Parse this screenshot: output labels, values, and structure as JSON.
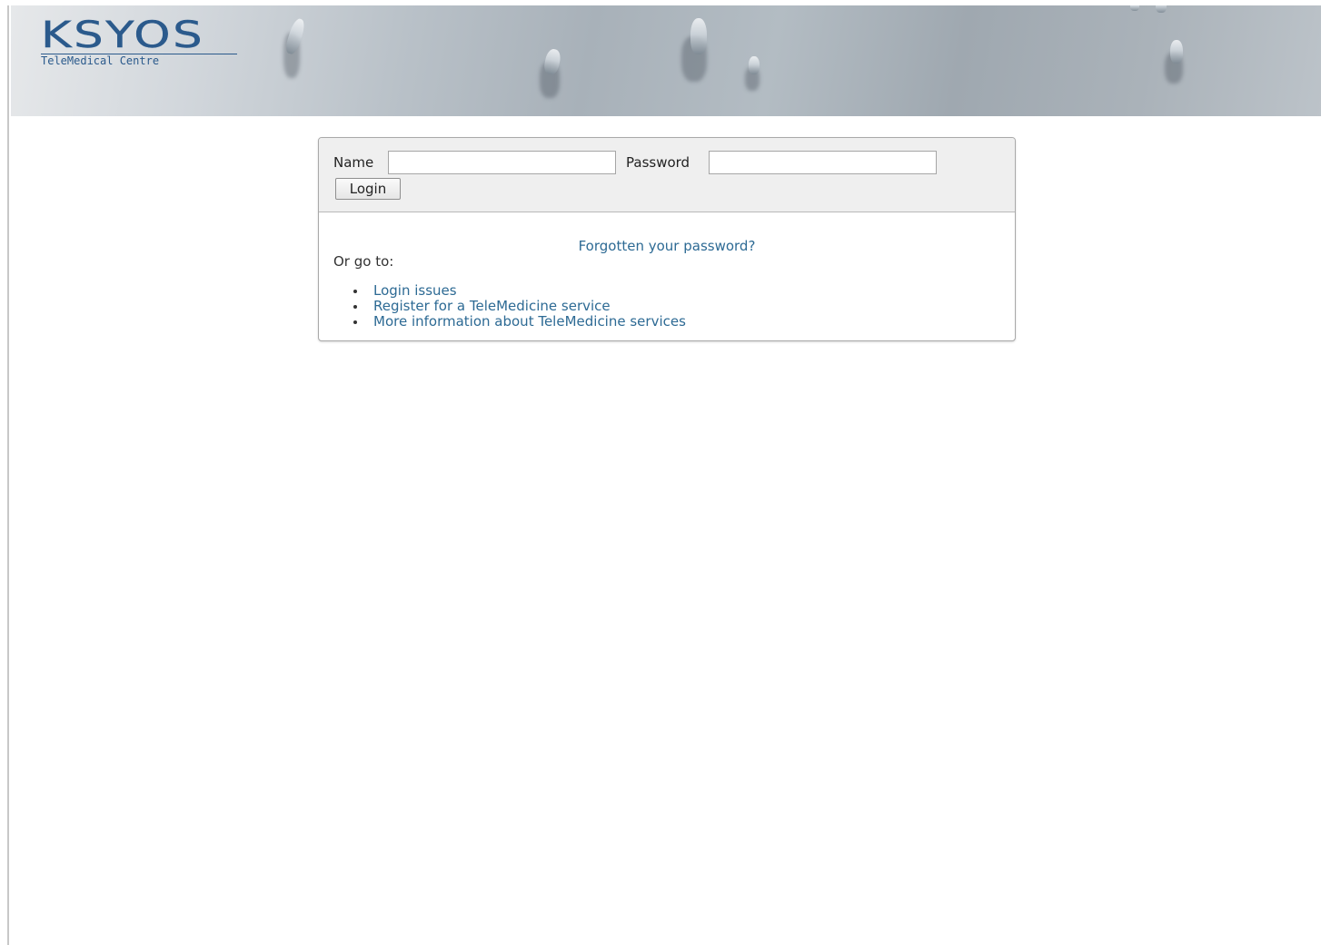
{
  "header": {
    "logo_main": "KSYOS",
    "logo_sub": "TeleMedical Centre"
  },
  "login": {
    "name_label": "Name",
    "name_value": "",
    "password_label": "Password",
    "password_value": "",
    "login_button": "Login"
  },
  "links": {
    "forgot_password": "Forgotten your password?",
    "goto_label": "Or go to:",
    "items": [
      {
        "label": "Login issues"
      },
      {
        "label": "Register for a TeleMedicine service"
      },
      {
        "label": "More information about TeleMedicine services"
      }
    ]
  }
}
